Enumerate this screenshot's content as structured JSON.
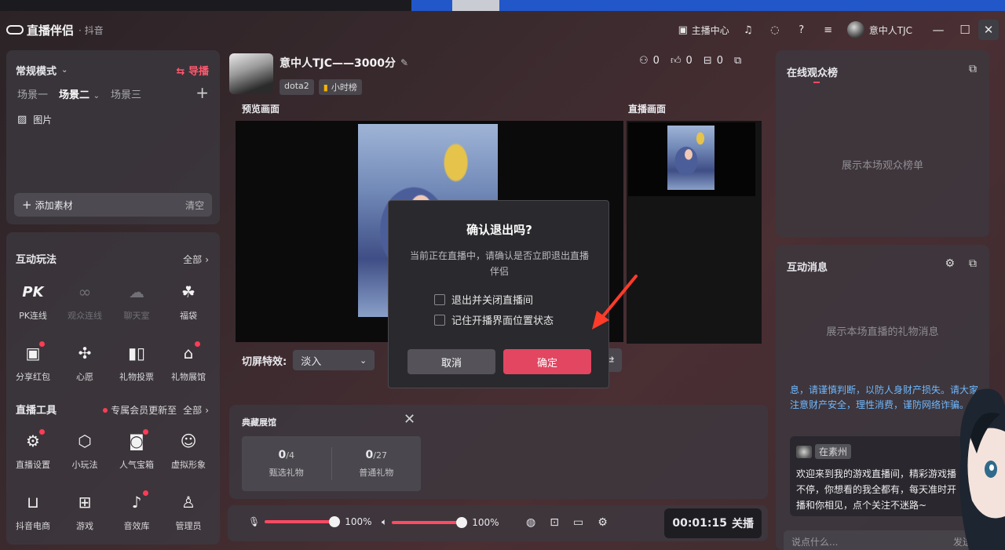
{
  "app": {
    "name": "直播伴侣",
    "platform": "· 抖音",
    "creator_center": "主播中心",
    "username": "意中人TJC"
  },
  "scene_panel": {
    "mode": "常规模式",
    "guide": "导播",
    "scenes": [
      "场景一",
      "场景二",
      "场景三"
    ],
    "active_scene": 1,
    "item_label": "图片",
    "add_material": "添加素材",
    "clear": "清空"
  },
  "tools_panel": {
    "interactive_title": "互动玩法",
    "interactive_all": "全部",
    "interactive_items": [
      {
        "label": "PK连线",
        "icon": "pk-icon",
        "dim": false,
        "badge": false
      },
      {
        "label": "观众连线",
        "icon": "audience-link-icon",
        "dim": true,
        "badge": false
      },
      {
        "label": "聊天室",
        "icon": "chatroom-icon",
        "dim": true,
        "badge": false
      },
      {
        "label": "福袋",
        "icon": "lucky-bag-icon",
        "dim": false,
        "badge": false
      },
      {
        "label": "分享红包",
        "icon": "red-packet-icon",
        "dim": false,
        "badge": true
      },
      {
        "label": "心愿",
        "icon": "wish-icon",
        "dim": false,
        "badge": false
      },
      {
        "label": "礼物投票",
        "icon": "gift-vote-icon",
        "dim": false,
        "badge": false
      },
      {
        "label": "礼物展馆",
        "icon": "gift-gallery-icon",
        "dim": false,
        "badge": true
      }
    ],
    "live_tools_title": "直播工具",
    "live_tools_notice": "专属会员更新至",
    "live_tools_all": "全部",
    "live_tool_items": [
      {
        "label": "直播设置",
        "icon": "live-settings-icon",
        "badge": true
      },
      {
        "label": "小玩法",
        "icon": "mini-game-icon",
        "badge": false
      },
      {
        "label": "人气宝箱",
        "icon": "treasure-box-icon",
        "badge": true
      },
      {
        "label": "虚拟形象",
        "icon": "avatar-figure-icon",
        "badge": false
      },
      {
        "label": "抖音电商",
        "icon": "shop-cart-icon",
        "badge": false
      },
      {
        "label": "游戏",
        "icon": "gamepad-icon",
        "badge": false
      },
      {
        "label": "音效库",
        "icon": "sound-effects-icon",
        "badge": true
      },
      {
        "label": "管理员",
        "icon": "admin-icon",
        "badge": false
      }
    ]
  },
  "stream_header": {
    "title": "意中人TJC——3000分",
    "tag_game": "dota2",
    "tag_rank": "小时榜",
    "viewers": "0",
    "likes": "0",
    "gifts": "0"
  },
  "preview": {
    "preview_label": "预览画面",
    "live_label": "直播画面",
    "effect_label": "切屏特效:",
    "effect_value": "淡入"
  },
  "collection": {
    "title": "典藏展馆",
    "selected_count": "0",
    "selected_total": "/4",
    "selected_label": "甄选礼物",
    "normal_count": "0",
    "normal_total": "/27",
    "normal_label": "普通礼物"
  },
  "controls": {
    "mic_volume": "100%",
    "speaker_volume": "100%",
    "mic_level": 1.0,
    "speaker_level": 1.0,
    "timer": "00:01:15",
    "end_live": "关播"
  },
  "audience_panel": {
    "title": "在线观众榜",
    "empty": "展示本场观众榜单"
  },
  "messages_panel": {
    "title": "互动消息",
    "empty": "展示本场直播的礼物消息",
    "notice": "息，请谨慎判断，以防人身财产损失。请大家注意财产安全，理性消费，谨防网络诈骗。",
    "chat_user": "在素州",
    "chat_text": "欢迎来到我的游戏直播间，精彩游戏播不停，你想看的我全都有，每天准时开播和你相见，点个关注不迷路~",
    "input_placeholder": "说点什么...",
    "send": "发送"
  },
  "dialog": {
    "title": "确认退出吗?",
    "desc": "当前正在直播中，请确认是否立即退出直播伴侣",
    "option1": "退出并关闭直播间",
    "option2": "记住开播界面位置状态",
    "cancel": "取消",
    "confirm": "确定"
  },
  "colors": {
    "accent": "#e24661",
    "link_blue": "#6fb8ff"
  }
}
